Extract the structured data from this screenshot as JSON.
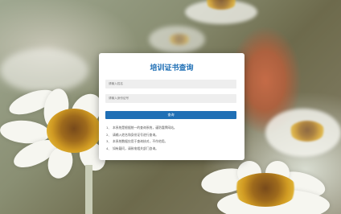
{
  "card": {
    "title": "培训证书查询",
    "name_placeholder": "请输入姓名",
    "id_placeholder": "请输入身份证号",
    "query_button": "查询",
    "notes": [
      {
        "num": "1、",
        "text": "本系统是根据统一的查询系统，谨防冒牌网站。"
      },
      {
        "num": "2、",
        "text": "请输入姓名和身份证号进行查询。"
      },
      {
        "num": "3、",
        "text": "本系统数据仅用于查询核对，不作他用。"
      },
      {
        "num": "4、",
        "text": "如有疑问，请致电相关部门咨询。"
      }
    ]
  },
  "colors": {
    "accent": "#1f6fb5",
    "input_bg": "#eeeeee"
  }
}
